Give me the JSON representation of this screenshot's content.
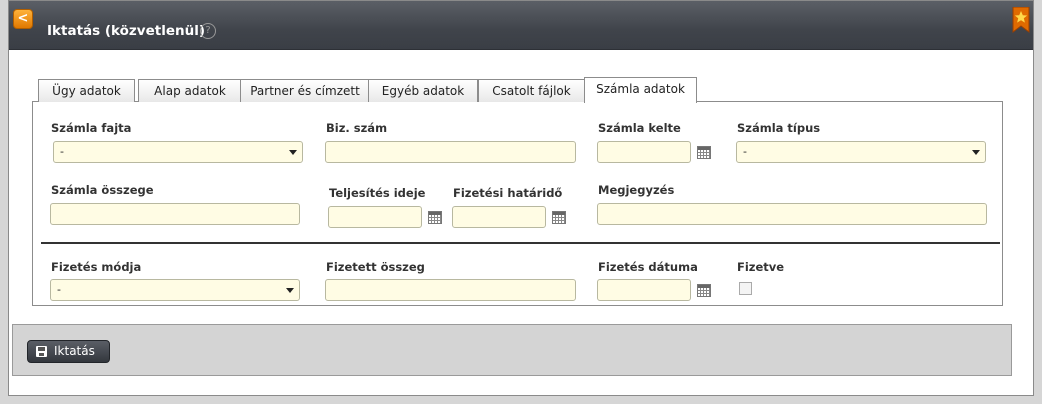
{
  "window": {
    "title": "Iktatás (közvetlenül)",
    "help_glyph": "?",
    "back_glyph": "<"
  },
  "tabs": [
    {
      "label": "Ügy adatok"
    },
    {
      "label": "Alap adatok"
    },
    {
      "label": "Partner és címzett"
    },
    {
      "label": "Egyéb adatok"
    },
    {
      "label": "Csatolt fájlok"
    },
    {
      "label": "Számla adatok",
      "active": true
    }
  ],
  "form": {
    "szamla_fajta": {
      "label": "Számla fajta",
      "value": "-"
    },
    "biz_szam": {
      "label": "Biz. szám",
      "value": ""
    },
    "szamla_kelte": {
      "label": "Számla kelte",
      "value": ""
    },
    "szamla_tipus": {
      "label": "Számla típus",
      "value": "-"
    },
    "szamla_osszege": {
      "label": "Számla összege",
      "value": ""
    },
    "teljesites_ideje": {
      "label": "Teljesítés ideje",
      "value": ""
    },
    "fizetesi_hatarido": {
      "label": "Fizetési határidő",
      "value": ""
    },
    "megjegyzes": {
      "label": "Megjegyzés",
      "value": ""
    },
    "fizetes_modja": {
      "label": "Fizetés módja",
      "value": "-"
    },
    "fizetett_osszeg": {
      "label": "Fizetett összeg",
      "value": ""
    },
    "fizetes_datuma": {
      "label": "Fizetés dátuma",
      "value": ""
    },
    "fizetve": {
      "label": "Fizetve",
      "checked": false
    }
  },
  "footer": {
    "submit_label": "Iktatás"
  },
  "colors": {
    "accent": "#f08a00",
    "input_bg": "#fffce4",
    "titlebar": "#44484f"
  }
}
